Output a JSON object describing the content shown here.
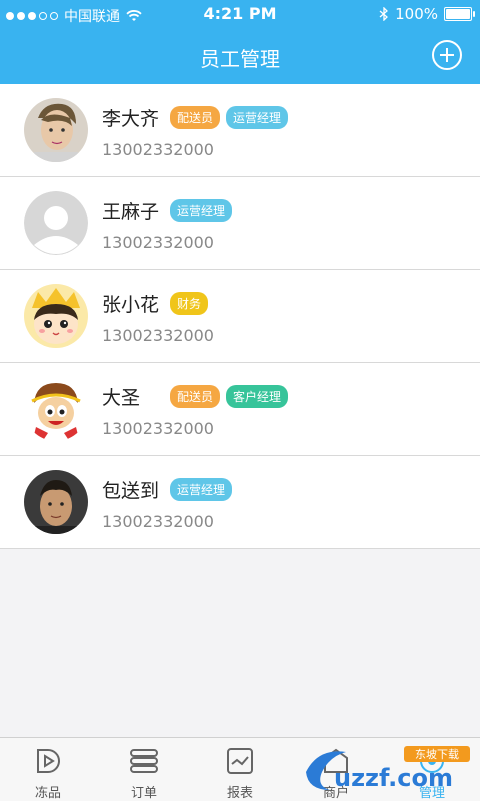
{
  "status": {
    "carrier": "中国联通",
    "time": "4:21 PM",
    "battery": "100%"
  },
  "header": {
    "title": "员工管理"
  },
  "employees": [
    {
      "name": "李大齐",
      "phone": "13002332000",
      "tags": [
        {
          "text": "配送员",
          "color": "#f5a742"
        },
        {
          "text": "运营经理",
          "color": "#5fc6e8"
        }
      ]
    },
    {
      "name": "王麻子",
      "phone": "13002332000",
      "tags": [
        {
          "text": "运营经理",
          "color": "#5fc6e8"
        }
      ]
    },
    {
      "name": "张小花",
      "phone": "13002332000",
      "tags": [
        {
          "text": "财务",
          "color": "#f0c51a"
        }
      ]
    },
    {
      "name": "大圣",
      "phone": "13002332000",
      "tags": [
        {
          "text": "配送员",
          "color": "#f5a742"
        },
        {
          "text": "客户经理",
          "color": "#37c49a"
        }
      ]
    },
    {
      "name": "包送到",
      "phone": "13002332000",
      "tags": [
        {
          "text": "运营经理",
          "color": "#5fc6e8"
        }
      ]
    }
  ],
  "tabs": [
    {
      "label": "冻品",
      "icon": "frozen-goods-icon"
    },
    {
      "label": "订单",
      "icon": "orders-icon"
    },
    {
      "label": "报表",
      "icon": "report-icon"
    },
    {
      "label": "商户",
      "icon": "merchant-icon"
    },
    {
      "label": "管理",
      "icon": "manage-icon",
      "active": true
    }
  ],
  "watermark": {
    "text": "uzzf.com",
    "badge": "东坡下载"
  },
  "colors": {
    "primary": "#39b3f0"
  }
}
